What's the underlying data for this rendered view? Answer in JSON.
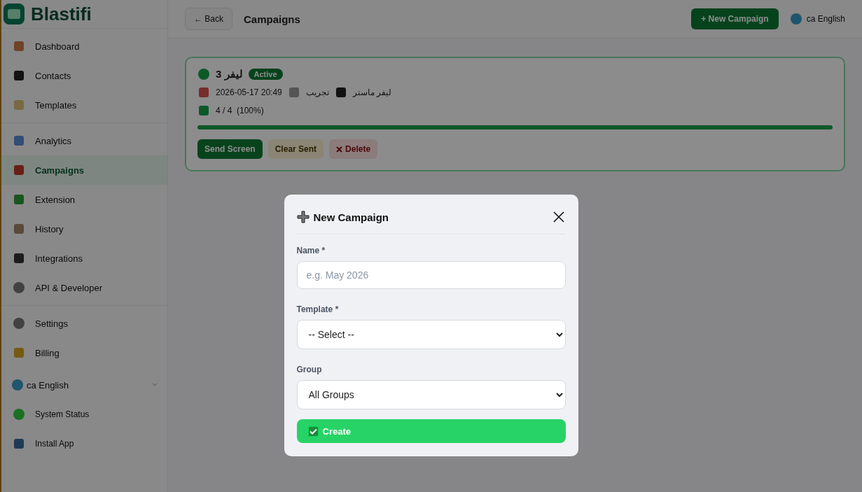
{
  "sidebar": {
    "logo": "Blastifi",
    "sections": [
      [
        {
          "label": "Dashboard",
          "selected": false
        },
        {
          "label": "Contacts",
          "selected": false
        },
        {
          "label": "Templates",
          "selected": false
        }
      ],
      [
        {
          "label": "Analytics",
          "selected": false
        },
        {
          "label": "Campaigns",
          "selected": true
        },
        {
          "label": "Extension",
          "selected": false
        },
        {
          "label": "History",
          "selected": false
        },
        {
          "label": "Integrations",
          "selected": false
        },
        {
          "label": "API & Developer",
          "selected": false
        }
      ],
      [
        {
          "label": "Settings",
          "selected": false
        },
        {
          "label": "Billing",
          "selected": false
        }
      ]
    ],
    "language": "ca English",
    "footer": [
      {
        "label": "System Status"
      },
      {
        "label": "Install App"
      }
    ]
  },
  "topbar": {
    "back": "← Back",
    "title": "Campaigns",
    "new_button": "+ New Campaign",
    "language": "ca English"
  },
  "campaigns": [
    {
      "title": "ليفر 3",
      "status": "Active",
      "date": "2026-05-17 20:49",
      "template": "تجريب",
      "group": "ليفر ماستر",
      "progress": "4 / 4  (100%)",
      "level": 1,
      "actions": [
        {
          "label": "Send Screen",
          "kind": "primary"
        },
        {
          "label": "Clear Sent",
          "kind": "warning"
        },
        {
          "label": "Delete",
          "kind": "danger"
        }
      ]
    }
  ],
  "modal": {
    "title": "New Campaign",
    "fields": [
      {
        "label": "Name *",
        "kind": "text",
        "placeholder": "e.g. May 2026"
      },
      {
        "label": "Template *",
        "kind": "select",
        "value": "-- Select --"
      },
      {
        "label": "Group",
        "kind": "select",
        "value": "All Groups"
      }
    ],
    "submit": "Create"
  }
}
